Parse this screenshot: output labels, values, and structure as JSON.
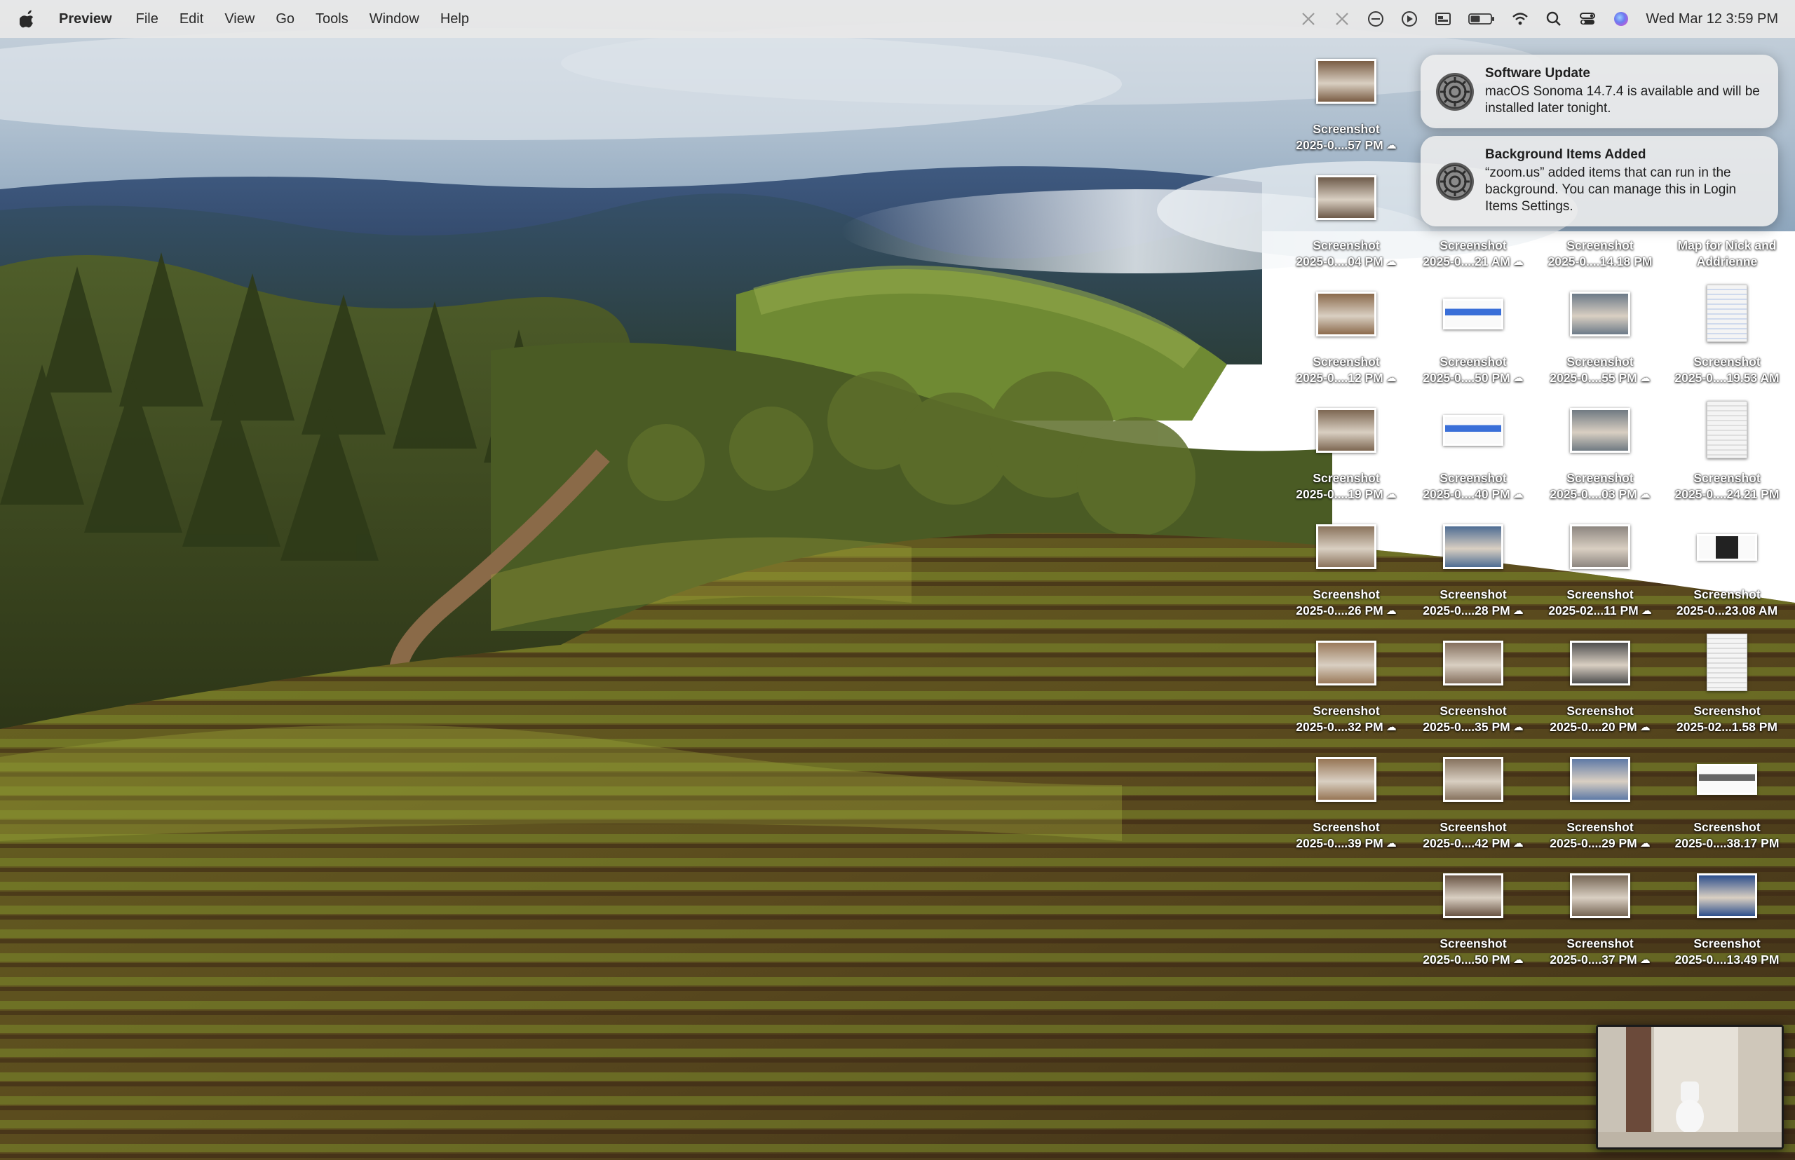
{
  "menubar": {
    "app_name": "Preview",
    "items": [
      "File",
      "Edit",
      "View",
      "Go",
      "Tools",
      "Window",
      "Help"
    ],
    "clock": "Wed Mar 12  3:59 PM",
    "status_icons": [
      "screen-record-icon",
      "screen-record-icon",
      "focus-icon",
      "play-icon",
      "window-icon",
      "battery-icon",
      "wifi-icon",
      "search-icon",
      "control-center-icon",
      "siri-icon"
    ]
  },
  "notifications": [
    {
      "title": "Software Update",
      "body": "macOS Sonoma 14.7.4 is available and will be installed later tonight."
    },
    {
      "title": "Background Items Added",
      "body": "“zoom.us” added items that can run in the background. You can manage this in Login Items Settings."
    }
  ],
  "desktop": {
    "icons": [
      {
        "col": 0,
        "row": 0,
        "name": "Screenshot",
        "date": "2025-0....57 PM",
        "kind": "photo",
        "tone": "#7a5d44",
        "cloud": true
      },
      {
        "col": 0,
        "row": 1,
        "name": "Screenshot",
        "date": "2025-0....04 PM",
        "kind": "photo",
        "tone": "#6d5a49",
        "cloud": true
      },
      {
        "col": 1,
        "row": 1,
        "name": "Screenshot",
        "date": "2025-0....21 AM",
        "kind": "none",
        "tone": "",
        "cloud": true
      },
      {
        "col": 2,
        "row": 1,
        "name": "Screenshot",
        "date": "2025-0....14.18 PM",
        "kind": "none",
        "tone": "",
        "cloud": false
      },
      {
        "col": 3,
        "row": 1,
        "name": "Map for Nick and",
        "date": "Addrienne",
        "kind": "none",
        "tone": "",
        "cloud": false
      },
      {
        "col": 0,
        "row": 2,
        "name": "Screenshot",
        "date": "2025-0....12 PM",
        "kind": "photo",
        "tone": "#8b6a4c",
        "cloud": true
      },
      {
        "col": 1,
        "row": 2,
        "name": "Screenshot",
        "date": "2025-0....50 PM",
        "kind": "wide",
        "tone": "#3a6fd8",
        "cloud": true
      },
      {
        "col": 2,
        "row": 2,
        "name": "Screenshot",
        "date": "2025-0....55 PM",
        "kind": "photo",
        "tone": "#6c7a88",
        "cloud": true
      },
      {
        "col": 3,
        "row": 2,
        "name": "Screenshot",
        "date": "2025-0....19.53 AM",
        "kind": "doc",
        "tone": "#3b6fd1",
        "cloud": false
      },
      {
        "col": 0,
        "row": 3,
        "name": "Screenshot",
        "date": "2025-0....19 PM",
        "kind": "photo",
        "tone": "#7d6752",
        "cloud": true
      },
      {
        "col": 1,
        "row": 3,
        "name": "Screenshot",
        "date": "2025-0....40 PM",
        "kind": "wide",
        "tone": "#3a6fd8",
        "cloud": true
      },
      {
        "col": 2,
        "row": 3,
        "name": "Screenshot",
        "date": "2025-0....03 PM",
        "kind": "photo",
        "tone": "#707a82",
        "cloud": true
      },
      {
        "col": 3,
        "row": 3,
        "name": "Screenshot",
        "date": "2025-0....24.21 PM",
        "kind": "doc",
        "tone": "#888888",
        "cloud": false
      },
      {
        "col": 0,
        "row": 4,
        "name": "Screenshot",
        "date": "2025-0....26 PM",
        "kind": "photo",
        "tone": "#8a735c",
        "cloud": true
      },
      {
        "col": 1,
        "row": 4,
        "name": "Screenshot",
        "date": "2025-0....28 PM",
        "kind": "photo",
        "tone": "#4e6d93",
        "cloud": true
      },
      {
        "col": 2,
        "row": 4,
        "name": "Screenshot",
        "date": "2025-02...11 PM",
        "kind": "photo",
        "tone": "#8d8680",
        "cloud": true
      },
      {
        "col": 3,
        "row": 4,
        "name": "Screenshot",
        "date": "2025-0...23.08 AM",
        "kind": "dark",
        "tone": "#222222",
        "cloud": false
      },
      {
        "col": 0,
        "row": 5,
        "name": "Screenshot",
        "date": "2025-0....32 PM",
        "kind": "photo",
        "tone": "#9a7a5b",
        "cloud": true
      },
      {
        "col": 1,
        "row": 5,
        "name": "Screenshot",
        "date": "2025-0....35 PM",
        "kind": "photo",
        "tone": "#85705e",
        "cloud": true
      },
      {
        "col": 2,
        "row": 5,
        "name": "Screenshot",
        "date": "2025-0....20 PM",
        "kind": "photo",
        "tone": "#4f4f4f",
        "cloud": true
      },
      {
        "col": 3,
        "row": 5,
        "name": "Screenshot",
        "date": "2025-02...1.58 PM",
        "kind": "doc",
        "tone": "#777777",
        "cloud": false
      },
      {
        "col": 0,
        "row": 6,
        "name": "Screenshot",
        "date": "2025-0....39 PM",
        "kind": "photo",
        "tone": "#977656",
        "cloud": true
      },
      {
        "col": 1,
        "row": 6,
        "name": "Screenshot",
        "date": "2025-0....42 PM",
        "kind": "photo",
        "tone": "#87735f",
        "cloud": true
      },
      {
        "col": 2,
        "row": 6,
        "name": "Screenshot",
        "date": "2025-0....29 PM",
        "kind": "photo",
        "tone": "#5f7aa6",
        "cloud": true
      },
      {
        "col": 3,
        "row": 6,
        "name": "Screenshot",
        "date": "2025-0....38.17 PM",
        "kind": "wide",
        "tone": "#666666",
        "cloud": false
      },
      {
        "col": 1,
        "row": 7,
        "name": "Screenshot",
        "date": "2025-0....50 PM",
        "kind": "photo",
        "tone": "#6a5545",
        "cloud": true
      },
      {
        "col": 2,
        "row": 7,
        "name": "Screenshot",
        "date": "2025-0....37 PM",
        "kind": "photo",
        "tone": "#766655",
        "cloud": true
      },
      {
        "col": 3,
        "row": 7,
        "name": "Screenshot",
        "date": "2025-0....13.49 PM",
        "kind": "photo",
        "tone": "#2d4f8c",
        "cloud": false
      }
    ]
  }
}
